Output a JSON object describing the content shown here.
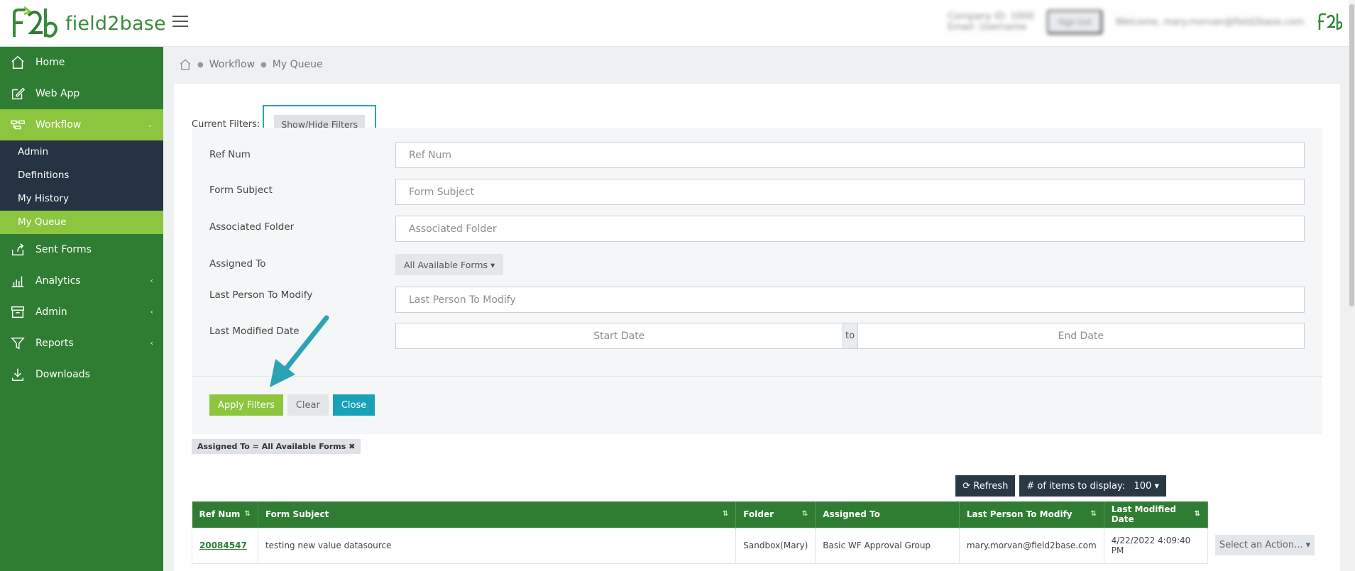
{
  "app": {
    "brand": "field2base"
  },
  "topbar": {
    "company_line1": "Company ID: 1000",
    "company_line2": "Email: Username",
    "user_button": "Sign Out",
    "welcome": "Welcome, mary.morvan@field2base.com"
  },
  "sidebar": {
    "items": [
      {
        "label": "Home"
      },
      {
        "label": "Web App"
      },
      {
        "label": "Workflow"
      },
      {
        "label": "Sent Forms"
      },
      {
        "label": "Analytics"
      },
      {
        "label": "Admin"
      },
      {
        "label": "Reports"
      },
      {
        "label": "Downloads"
      }
    ],
    "workflow_sub": [
      {
        "label": "Admin"
      },
      {
        "label": "Definitions"
      },
      {
        "label": "My History"
      },
      {
        "label": "My Queue"
      }
    ]
  },
  "breadcrumb": {
    "items": [
      "Workflow",
      "My Queue"
    ]
  },
  "filters": {
    "current_label": "Current Filters:",
    "toggle_label": "Show/Hide Filters",
    "fields": {
      "ref_num": {
        "label": "Ref Num",
        "placeholder": "Ref Num"
      },
      "form_subject": {
        "label": "Form Subject",
        "placeholder": "Form Subject"
      },
      "associated_folder": {
        "label": "Associated Folder",
        "placeholder": "Associated Folder"
      },
      "assigned_to": {
        "label": "Assigned To",
        "value": "All Available Forms"
      },
      "last_person": {
        "label": "Last Person To Modify",
        "placeholder": "Last Person To Modify"
      },
      "last_modified": {
        "label": "Last Modified Date",
        "start_placeholder": "Start Date",
        "to": "to",
        "end_placeholder": "End Date"
      }
    },
    "apply_label": "Apply Filters",
    "clear_label": "Clear",
    "close_label": "Close",
    "active_chip": "Assigned To = All Available Forms"
  },
  "toolbar": {
    "refresh_label": "Refresh",
    "items_label": "# of items to display:",
    "items_value": "100"
  },
  "table": {
    "columns": [
      "Ref Num",
      "Form Subject",
      "Folder",
      "Assigned To",
      "Last Person To Modify",
      "Last Modified Date"
    ],
    "rows": [
      {
        "ref_num": "20084547",
        "subject": "testing new value datasource",
        "folder": "Sandbox(Mary)",
        "assigned": "Basic WF Approval Group",
        "last_person": "mary.morvan@field2base.com",
        "date": "4/22/2022 4:09:40 PM"
      }
    ],
    "action_label": "Select an Action..."
  },
  "colors": {
    "sidebar": "#2e7d32",
    "active": "#8cc63f",
    "submenu": "#253342",
    "accent": "#17a2b8",
    "highlight": "#2ba3b4"
  }
}
